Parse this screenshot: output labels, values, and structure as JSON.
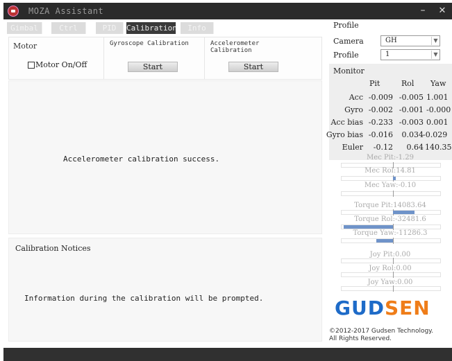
{
  "window": {
    "title": "MOZA Assistant",
    "minimize_glyph": "–",
    "close_glyph": "✕"
  },
  "tabs": [
    {
      "label": "Gimbal",
      "active": false
    },
    {
      "label": "Ctrl",
      "active": false
    },
    {
      "label": "PID",
      "active": false
    },
    {
      "label": "Calibration",
      "active": true
    },
    {
      "label": "Info",
      "active": false
    }
  ],
  "calibration": {
    "motor": {
      "title": "Motor",
      "checkbox_label": "Motor On/Off",
      "checked": false
    },
    "gyro": {
      "title": "Gyroscope Calibration",
      "button": "Start"
    },
    "accel": {
      "title": "Accelerometer Calibration",
      "button": "Start"
    },
    "message": "Accelerometer calibration success."
  },
  "notices": {
    "title": "Calibration Notices",
    "text": "Information during the calibration will be prompted."
  },
  "profile": {
    "heading": "Profile",
    "camera_label": "Camera",
    "camera_value": "GH",
    "profile_label": "Profile",
    "profile_value": "1"
  },
  "monitor": {
    "heading": "Monitor",
    "columns": [
      "Pit",
      "Rol",
      "Yaw"
    ],
    "rows": [
      {
        "label": "Acc",
        "pit": "-0.009",
        "rol": "-0.005",
        "yaw": "1.001"
      },
      {
        "label": "Gyro",
        "pit": "-0.002",
        "rol": "-0.001",
        "yaw": "-0.000"
      },
      {
        "label": "Acc bias",
        "pit": "-0.233",
        "rol": "-0.003",
        "yaw": "0.001"
      },
      {
        "label": "Gyro bias",
        "pit": "-0.016",
        "rol": "0.034",
        "yaw": "-0.029"
      },
      {
        "label": "Euler",
        "pit": "-0.12",
        "rol": "0.64",
        "yaw": "140.35"
      }
    ]
  },
  "meters": [
    {
      "label": "Mec Pit:-1.29",
      "fill": 0.0
    },
    {
      "label": "Mec Rol:14.81",
      "fill": 0.03
    },
    {
      "label": "Mec Yaw:-0.10",
      "fill": 0.0
    },
    {
      "label": "Torque Pit:14083.64",
      "fill": 0.22
    },
    {
      "label": "Torque Rol:-32481.6",
      "fill": -0.5
    },
    {
      "label": "Torque Yaw:-11286.3",
      "fill": -0.17
    },
    {
      "label": "Joy Pit:0.00",
      "fill": 0.0
    },
    {
      "label": "Joy Rol:0.00",
      "fill": 0.0
    },
    {
      "label": "Joy Yaw:0.00",
      "fill": 0.0
    }
  ],
  "brand": {
    "part1": "GUD",
    "part2": "SEN",
    "color_primary": "#1e6bc8",
    "color_accent": "#ef7d19"
  },
  "copyright": {
    "line1": "©2012-2017 Gudsen Technology.",
    "line2": "All Rights Reserved."
  }
}
